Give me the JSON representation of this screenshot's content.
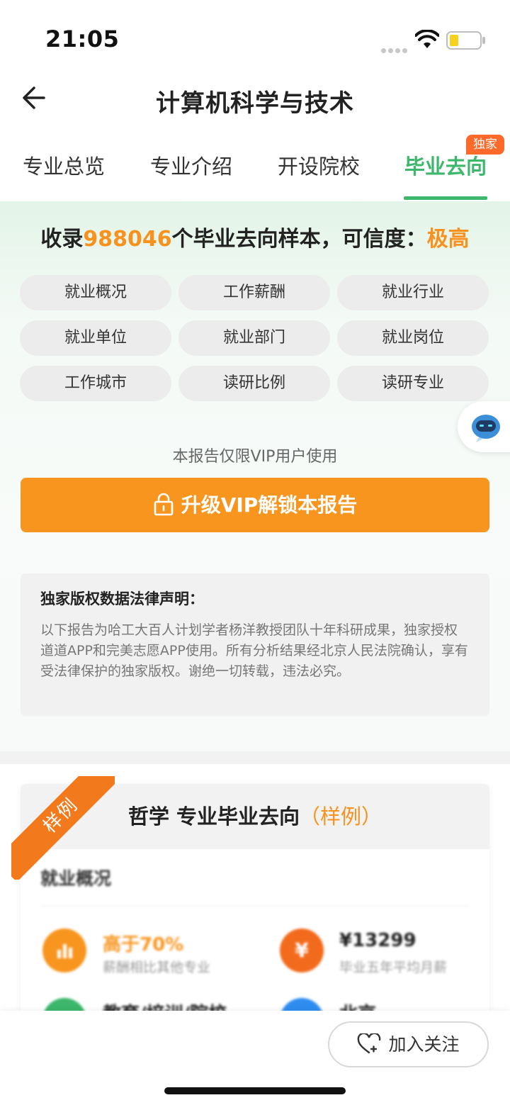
{
  "status_bar": {
    "time": "21:05",
    "icons": [
      "signal-dots-icon",
      "wifi-icon",
      "battery-icon"
    ]
  },
  "nav": {
    "title": "计算机科学与技术",
    "back_icon": "back-arrow-icon"
  },
  "tabs": [
    {
      "label": "专业总览",
      "active": false
    },
    {
      "label": "专业介绍",
      "active": false
    },
    {
      "label": "开设院校",
      "active": false
    },
    {
      "label": "毕业去向",
      "active": true,
      "badge": "独家"
    }
  ],
  "summary": {
    "prefix": "收录",
    "count": "988046",
    "middle": "个毕业去向样本，可信度：",
    "level": "极高"
  },
  "chips": [
    "就业概况",
    "工作薪酬",
    "就业行业",
    "就业单位",
    "就业部门",
    "就业岗位",
    "工作城市",
    "读研比例",
    "读研专业"
  ],
  "vip": {
    "note": "本报告仅限VIP用户使用",
    "button_label": "升级VIP解锁本报告"
  },
  "legal": {
    "title": "独家版权数据法律声明：",
    "body": "以下报告为哈工大百人计划学者杨洋教授团队十年科研成果，独家授权道道APP和完美志愿APP使用。所有分析结果经北京人民法院确认，享有受法律保护的独家版权。谢绝一切转载，违法必究。"
  },
  "sample": {
    "ribbon": "样例",
    "title_main": "哲学 专业毕业去向",
    "title_hl": "（样例）",
    "section_title": "就业概况",
    "stats": [
      {
        "icon": "bar-chart-icon",
        "value": "高于70%",
        "caption": "薪酬相比其他专业",
        "color": "#f7951e"
      },
      {
        "icon": "yen-icon",
        "value": "¥13299",
        "caption": "毕业五年平均月薪",
        "color": "#f26b1d"
      },
      {
        "icon": "education-icon",
        "value": "教育/培训/院校",
        "caption": "",
        "color": "#3cb76b"
      },
      {
        "icon": "location-icon",
        "value": "北京",
        "caption": "",
        "color": "#2f8df0"
      }
    ]
  },
  "bottom": {
    "follow_label": "加入关注"
  },
  "colors": {
    "accent_green": "#3cb76b",
    "accent_orange": "#f7951e",
    "badge_orange": "#ff6a2a"
  }
}
